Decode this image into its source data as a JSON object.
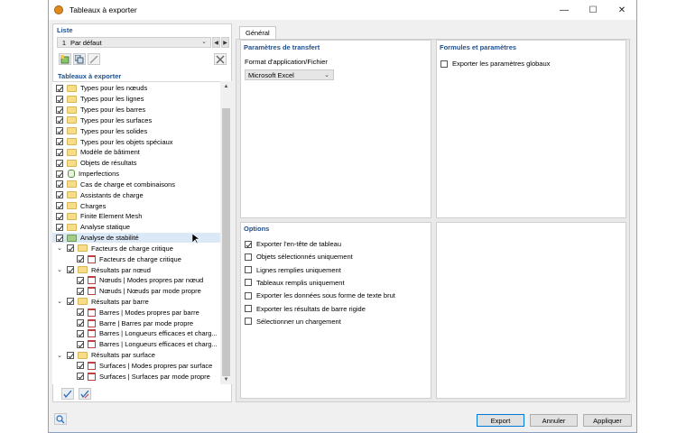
{
  "window": {
    "title": "Tableaux à exporter",
    "minimize": "—",
    "maximize": "☐",
    "close": "✕"
  },
  "list_panel": {
    "label": "Liste",
    "selected_number": "1",
    "selected_name": "Par défaut"
  },
  "tables_panel": {
    "label": "Tableaux à exporter",
    "items": [
      {
        "label": "Types pour les nœuds",
        "checked": true,
        "level": 0,
        "icon": "folder-icon"
      },
      {
        "label": "Types pour les lignes",
        "checked": true,
        "level": 0,
        "icon": "folder-icon"
      },
      {
        "label": "Types pour les barres",
        "checked": true,
        "level": 0,
        "icon": "folder-icon"
      },
      {
        "label": "Types pour les surfaces",
        "checked": true,
        "level": 0,
        "icon": "folder-icon"
      },
      {
        "label": "Types pour les solides",
        "checked": true,
        "level": 0,
        "icon": "folder-icon"
      },
      {
        "label": "Types pour les objets spéciaux",
        "checked": true,
        "level": 0,
        "icon": "folder-icon"
      },
      {
        "label": "Modèle de bâtiment",
        "checked": true,
        "level": 0,
        "icon": "folder-icon"
      },
      {
        "label": "Objets de résultats",
        "checked": true,
        "level": 0,
        "icon": "folder-icon"
      },
      {
        "label": "Imperfections",
        "checked": true,
        "level": 0,
        "icon": "imperfection-icon"
      },
      {
        "label": "Cas de charge et combinaisons",
        "checked": true,
        "level": 0,
        "icon": "folder-icon"
      },
      {
        "label": "Assistants de charge",
        "checked": true,
        "level": 0,
        "icon": "folder-icon"
      },
      {
        "label": "Charges",
        "checked": true,
        "level": 0,
        "icon": "folder-icon"
      },
      {
        "label": "Finite Element Mesh",
        "checked": true,
        "level": 0,
        "icon": "folder-icon"
      },
      {
        "label": "Analyse statique",
        "checked": true,
        "level": 0,
        "icon": "folder-icon"
      },
      {
        "label": "Analyse de stabilité",
        "checked": true,
        "level": 0,
        "icon": "folder-green-icon",
        "selected": true
      },
      {
        "label": "Facteurs de charge critique",
        "checked": true,
        "level": 1,
        "icon": "folder-icon",
        "expanded": true
      },
      {
        "label": "Facteurs de charge critique",
        "checked": true,
        "level": 2,
        "icon": "table-icon"
      },
      {
        "label": "Résultats par nœud",
        "checked": true,
        "level": 1,
        "icon": "folder-icon",
        "expanded": true
      },
      {
        "label": "Nœuds | Modes propres par nœud",
        "checked": true,
        "level": 2,
        "icon": "table-icon"
      },
      {
        "label": "Nœuds | Nœuds par mode propre",
        "checked": true,
        "level": 2,
        "icon": "table-icon"
      },
      {
        "label": "Résultats par barre",
        "checked": true,
        "level": 1,
        "icon": "folder-icon",
        "expanded": true
      },
      {
        "label": "Barres | Modes propres par barre",
        "checked": true,
        "level": 2,
        "icon": "table-icon"
      },
      {
        "label": "Barre | Barres par mode propre",
        "checked": true,
        "level": 2,
        "icon": "table-icon"
      },
      {
        "label": "Barres | Longueurs efficaces et charg...",
        "checked": true,
        "level": 2,
        "icon": "table-icon"
      },
      {
        "label": "Barres | Longueurs efficaces et charg...",
        "checked": true,
        "level": 2,
        "icon": "table-icon"
      },
      {
        "label": "Résultats par surface",
        "checked": true,
        "level": 1,
        "icon": "folder-icon",
        "expanded": true
      },
      {
        "label": "Surfaces | Modes propres par surface",
        "checked": true,
        "level": 2,
        "icon": "table-icon"
      },
      {
        "label": "Surfaces | Surfaces par mode propre",
        "checked": true,
        "level": 2,
        "icon": "table-icon"
      }
    ]
  },
  "tabs": [
    {
      "label": "Général",
      "active": true
    }
  ],
  "transfer": {
    "title": "Paramètres de transfert",
    "format_label": "Format d'application/Fichier",
    "format_value": "Microsoft Excel"
  },
  "formulas": {
    "title": "Formules et paramètres",
    "export_global_params": {
      "label": "Exporter les paramètres globaux",
      "checked": false
    }
  },
  "options": {
    "title": "Options",
    "items": [
      {
        "label": "Exporter l'en-tête de tableau",
        "checked": true
      },
      {
        "label": "Objets sélectionnés uniquement",
        "checked": false
      },
      {
        "label": "Lignes remplies uniquement",
        "checked": false
      },
      {
        "label": "Tableaux remplis uniquement",
        "checked": false
      },
      {
        "label": "Exporter les données sous forme de texte brut",
        "checked": false
      },
      {
        "label": "Exporter les résultats de barre rigide",
        "checked": false
      },
      {
        "label": "Sélectionner un chargement",
        "checked": false
      }
    ]
  },
  "buttons": {
    "export": "Export",
    "cancel": "Annuler",
    "apply": "Appliquer"
  }
}
